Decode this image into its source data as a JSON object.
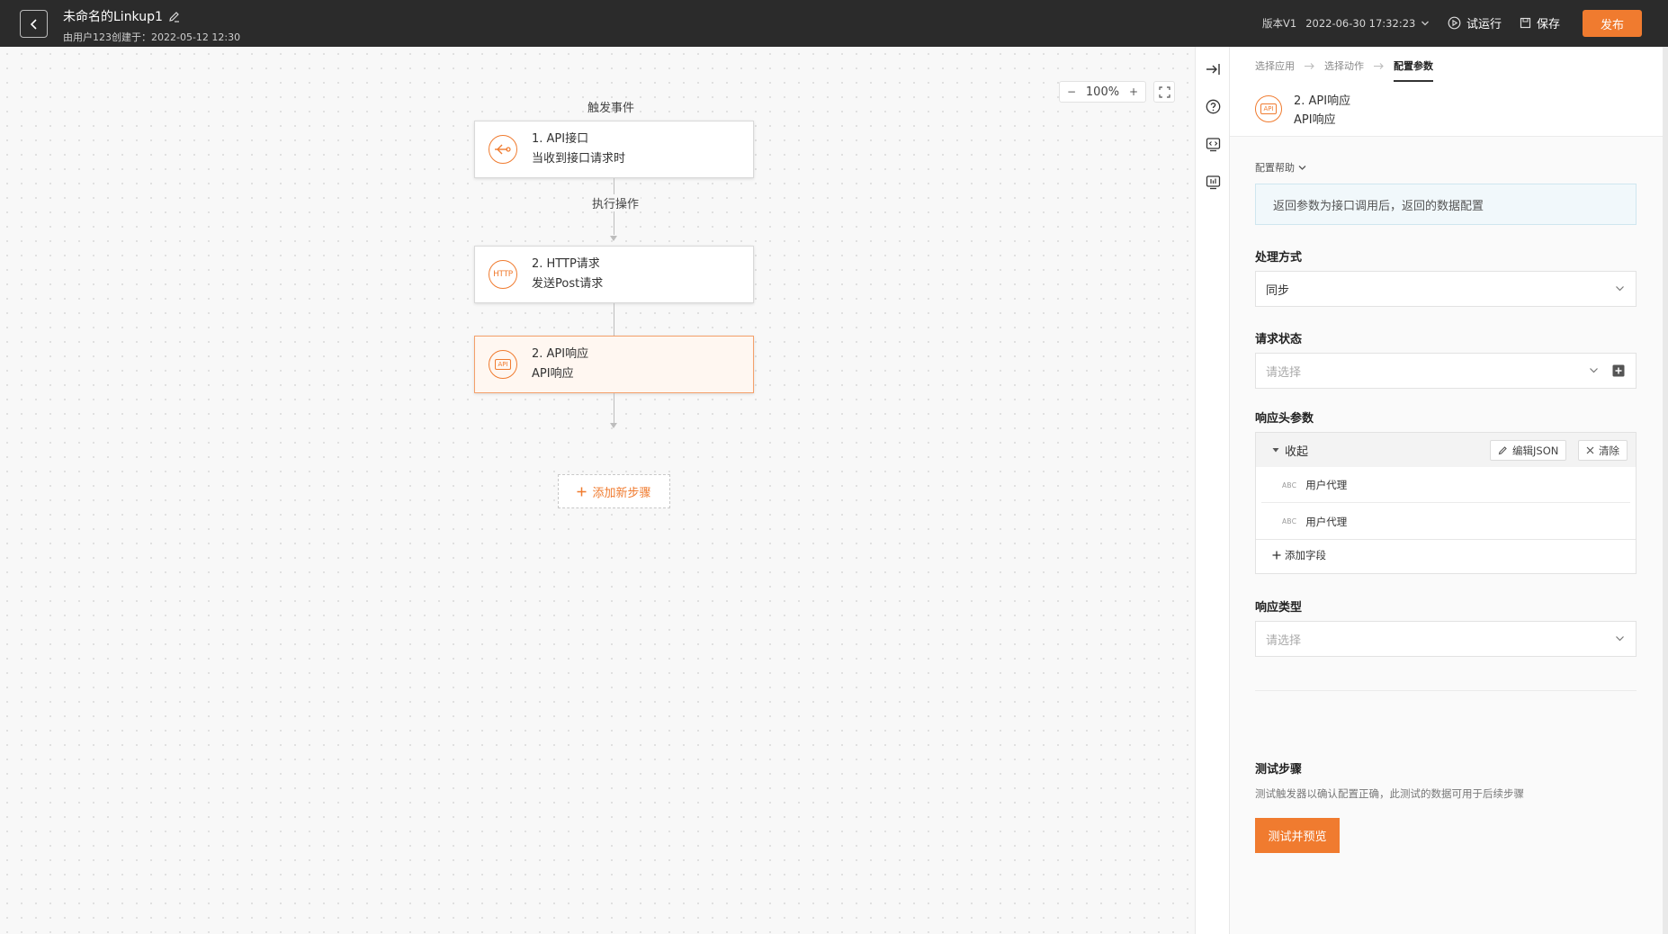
{
  "header": {
    "title": "未命名的Linkup1",
    "subtitle": "由用户123创建于：2022-05-12 12:30",
    "version": "版本V1",
    "version_time": "2022-06-30 17:32:23",
    "test_run": "试运行",
    "save": "保存",
    "publish": "发布"
  },
  "canvas": {
    "zoom_level": "100%",
    "zoom_out": "−",
    "zoom_in": "+",
    "trigger_label": "触发事件",
    "action_label": "执行操作",
    "nodes": [
      {
        "title": "1. API接口",
        "desc": "当收到接口请求时",
        "icon": "api-trigger-icon"
      },
      {
        "title": "2. HTTP请求",
        "desc": "发送Post请求",
        "icon": "http-icon",
        "icon_text": "HTTP"
      },
      {
        "title": "2. API响应",
        "desc": "API响应",
        "icon": "api-response-icon",
        "icon_text": "API"
      }
    ],
    "add_step": "添加新步骤"
  },
  "panel": {
    "steps": [
      "选择应用",
      "选择动作",
      "配置参数"
    ],
    "node_title": "2. API响应",
    "node_desc": "API响应",
    "node_icon_text": "API",
    "help_toggle": "配置帮助",
    "help_text": "返回参数为接口调用后，返回的数据配置",
    "mode_label": "处理方式",
    "mode_value": "同步",
    "status_label": "请求状态",
    "status_placeholder": "请选择",
    "headers_label": "响应头参数",
    "collapse": "收起",
    "edit_json": "编辑JSON",
    "clear": "清除",
    "header_rows": [
      {
        "type": "ABC",
        "name": "用户代理"
      },
      {
        "type": "ABC",
        "name": "用户代理"
      }
    ],
    "add_field": "添加字段",
    "resp_type_label": "响应类型",
    "resp_type_placeholder": "请选择",
    "test_title": "测试步骤",
    "test_desc": "测试触发器以确认配置正确，此测试的数据可用于后续步骤",
    "test_btn": "测试并预览"
  },
  "colors": {
    "accent": "#f07b2f",
    "topbar": "#2b2b2b"
  }
}
